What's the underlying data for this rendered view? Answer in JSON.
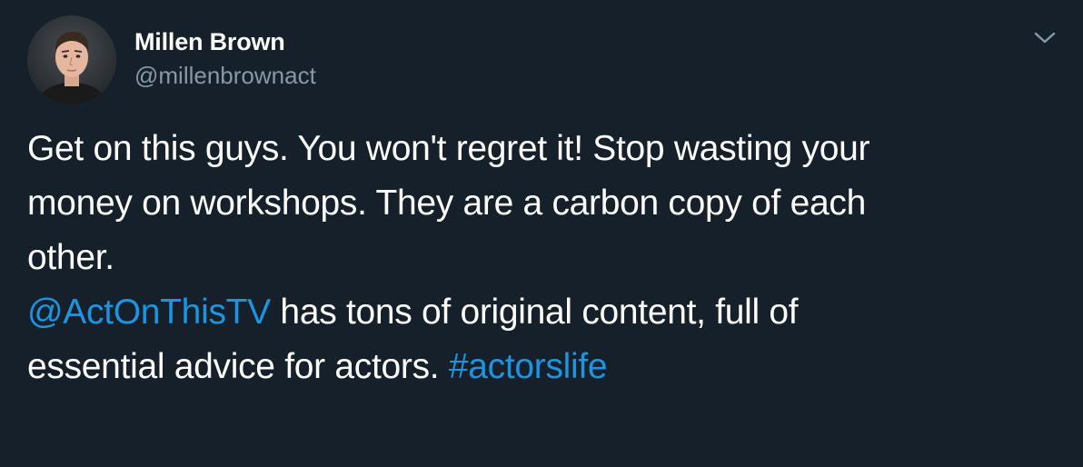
{
  "author": {
    "display_name": "Millen Brown",
    "handle": "@millenbrownact",
    "avatar_icon": "profile-photo"
  },
  "menu": {
    "icon": "chevron-down-icon"
  },
  "tweet": {
    "line1": "Get on this guys. You won't regret it! Stop wasting your",
    "line2": "money on workshops. They are a carbon copy of each",
    "line3": "other.",
    "mention": "@ActOnThisTV",
    "line4_rest": " has tons of original content, full of",
    "line5_start": "essential advice for actors. ",
    "hashtag": "#actorslife"
  },
  "colors": {
    "background": "#15202b",
    "text": "#ffffff",
    "secondary": "#8899a6",
    "link": "#1b95e0"
  }
}
